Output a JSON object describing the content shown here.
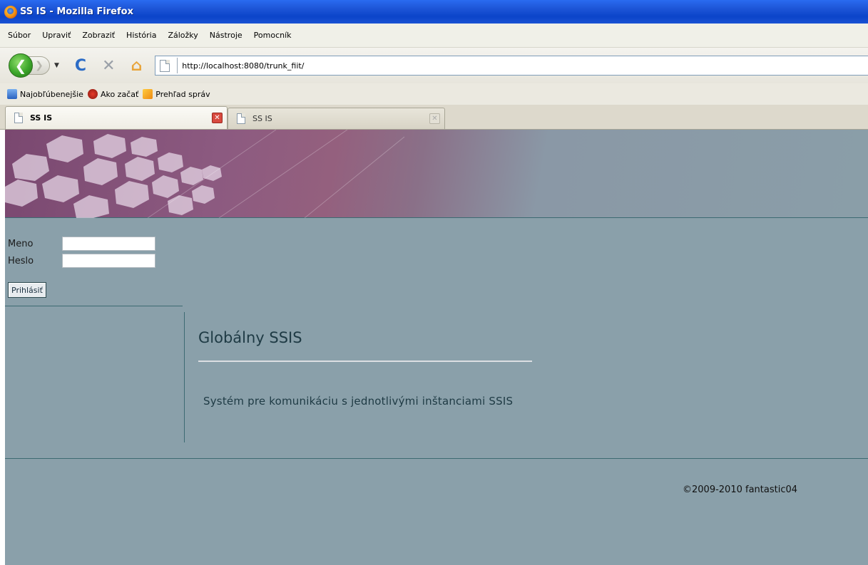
{
  "window": {
    "title": "SS IS - Mozilla Firefox"
  },
  "menubar": {
    "items": [
      "Súbor",
      "Upraviť",
      "Zobraziť",
      "História",
      "Záložky",
      "Nástroje",
      "Pomocník"
    ]
  },
  "navbar": {
    "url": "http://localhost:8080/trunk_fiit/"
  },
  "bookmarks": {
    "items": [
      "Najobľúbenejšie",
      "Ako začať",
      "Prehľad správ"
    ]
  },
  "tabs": [
    {
      "label": "SS IS",
      "active": true
    },
    {
      "label": "SS IS",
      "active": false
    }
  ],
  "login": {
    "username_label": "Meno",
    "password_label": "Heslo",
    "username_value": "",
    "password_value": "",
    "submit_label": "Prihlásiť"
  },
  "main": {
    "title": "Globálny SSIS",
    "description": "Systém pre komunikáciu s jednotlivými inštanciami SSIS"
  },
  "footer": {
    "copyright": "©2009-2010 fantastic04"
  },
  "colors": {
    "page_background": "#8aa0aa",
    "separator": "#3d6a72",
    "title_text": "#1e3a44"
  }
}
